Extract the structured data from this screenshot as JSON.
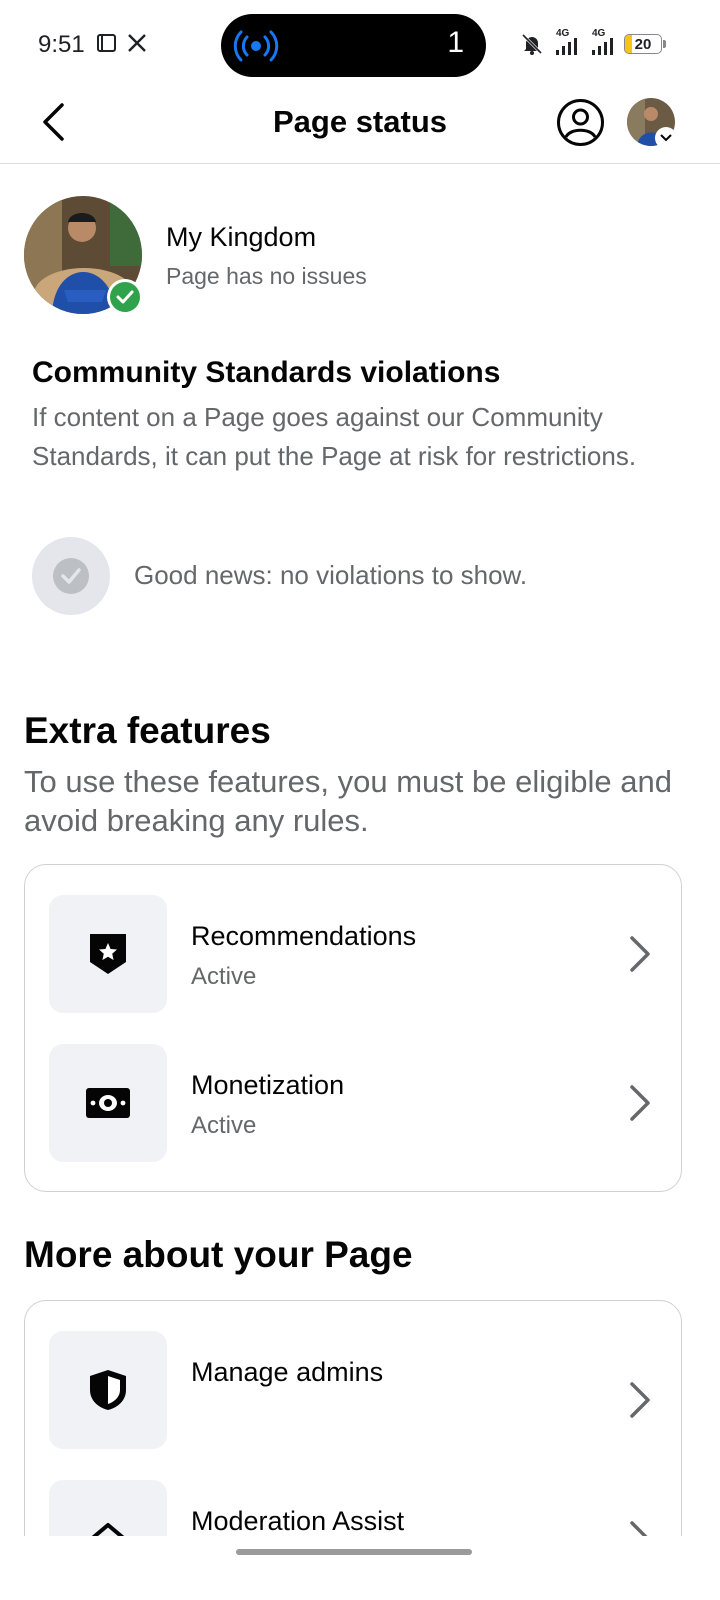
{
  "status_bar": {
    "time": "9:51",
    "notification_count": "1",
    "signal_1": "4G",
    "signal_2": "4G",
    "battery": "20",
    "battery_color": "#f5c518"
  },
  "header": {
    "title": "Page status",
    "back_icon": "back-arrow-icon",
    "profile_icon": "profile-icon"
  },
  "page": {
    "name": "My Kingdom",
    "status": "Page has no issues"
  },
  "community": {
    "title": "Community Standards violations",
    "description": "If content on a Page goes against our Community Standards, it can put the Page at risk for restrictions.",
    "status_text": "Good news: no violations to show."
  },
  "extra_features": {
    "title": "Extra features",
    "description": "To use these features, you must be eligible and avoid breaking any rules.",
    "items": [
      {
        "label": "Recommendations",
        "status": "Active",
        "icon": "badge-star-icon"
      },
      {
        "label": "Monetization",
        "status": "Active",
        "icon": "money-icon"
      }
    ]
  },
  "more_about": {
    "title": "More about your Page",
    "items": [
      {
        "label": "Manage admins",
        "icon": "shield-icon"
      },
      {
        "label": "Moderation Assist",
        "icon": "moderation-icon"
      }
    ]
  },
  "colors": {
    "success": "#31a24c",
    "secondary_text": "#65676b",
    "icon_bg": "#f0f2f5"
  }
}
